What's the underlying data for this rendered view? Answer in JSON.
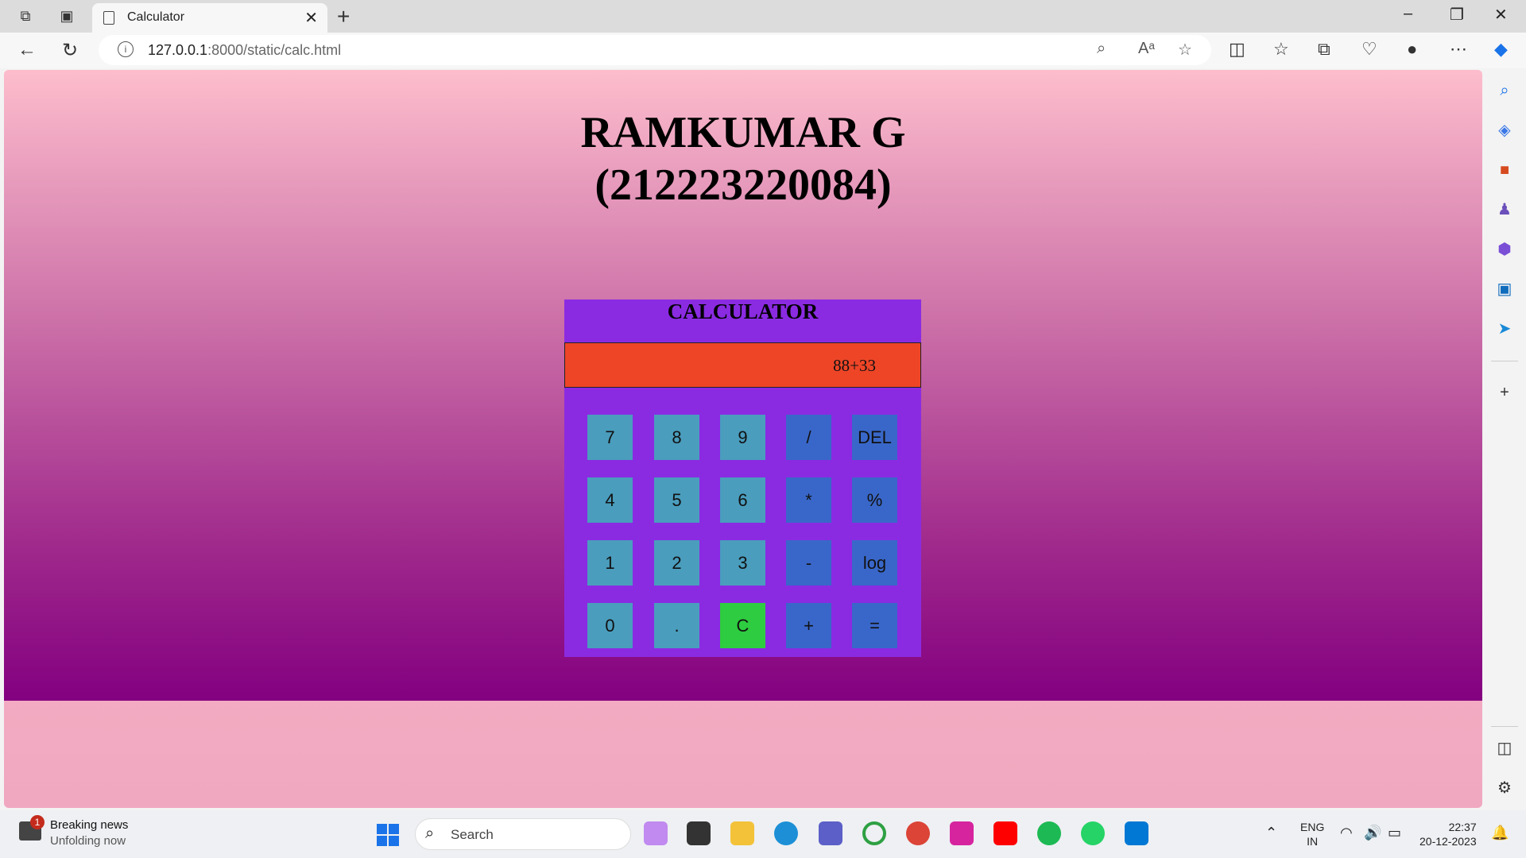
{
  "browser": {
    "tab_title": "Calculator",
    "url_host": "127.0.0.1",
    "url_rest": ":8000/static/calc.html"
  },
  "page": {
    "heading_line1": "RAMKUMAR G",
    "heading_line2": "(212223220084)"
  },
  "calculator": {
    "title": "CALCULATOR",
    "display": "88+33",
    "keys": {
      "k7": "7",
      "k8": "8",
      "k9": "9",
      "div": "/",
      "del": "DEL",
      "k4": "4",
      "k5": "5",
      "k6": "6",
      "mul": "*",
      "pct": "%",
      "k1": "1",
      "k2": "2",
      "k3": "3",
      "sub": "-",
      "log": "log",
      "k0": "0",
      "dot": ".",
      "clr": "C",
      "add": "+",
      "eq": "="
    },
    "colors": {
      "panel": "#8a2be2",
      "display": "#ee4527",
      "number_key": "#4a9dbd",
      "operator_key": "#3967c9",
      "clear_key": "#2ecc40"
    }
  },
  "taskbar": {
    "news_badge": "1",
    "news_title": "Breaking news",
    "news_subtitle": "Unfolding now",
    "search_label": "Search",
    "lang_line1": "ENG",
    "lang_line2": "IN",
    "time": "22:37",
    "date": "20-12-2023"
  }
}
